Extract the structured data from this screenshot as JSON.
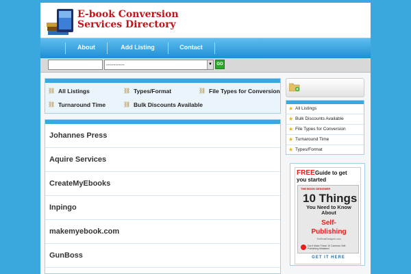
{
  "header": {
    "title_line1": "E-book Conversion",
    "title_line2": "Services Directory"
  },
  "nav": {
    "items": [
      {
        "label": "About"
      },
      {
        "label": "Add Listing"
      },
      {
        "label": "Contact"
      }
    ]
  },
  "search": {
    "input_value": "",
    "select_value": "----------",
    "go_label": "GO"
  },
  "categories": {
    "items": [
      {
        "label": "All Listings"
      },
      {
        "label": "Types/Format"
      },
      {
        "label": "File Types for Conversion"
      },
      {
        "label": "Turnaround Time"
      },
      {
        "label": "Bulk Discounts Available"
      }
    ]
  },
  "listings": {
    "items": [
      {
        "name": "Johannes Press"
      },
      {
        "name": "Aquire Services"
      },
      {
        "name": "CreateMyEbooks"
      },
      {
        "name": "Inpingo"
      },
      {
        "name": "makemyebook.com"
      },
      {
        "name": "GunBoss"
      }
    ]
  },
  "sidebar": {
    "items": [
      {
        "label": "All Listings"
      },
      {
        "label": "Bulk Discounts Available"
      },
      {
        "label": "File Types for Conversion"
      },
      {
        "label": "Turnaround Time"
      },
      {
        "label": "Types/Format"
      }
    ]
  },
  "ad": {
    "free": "FREE",
    "guide": "Guide to get",
    "started": "you started",
    "brand": "THE BOOK DESIGNER",
    "big": "10 Things",
    "sub": "You Need to Know About",
    "self": "Self-",
    "publishing": "Publishing",
    "site": "TheBookDesigner.com",
    "fine": "Don't Make These 10 Common Self-Publishing Mistakes!",
    "cta": "GET IT HERE"
  },
  "colors": {
    "background": "#3aa8df",
    "brand_red": "#c0141a",
    "nav_blue": "#1f8fd2",
    "go_green": "#2ea62e"
  },
  "icons": {
    "category": "link-chain-icon",
    "sidebar": "star-icon",
    "folder": "folder-add-icon"
  }
}
